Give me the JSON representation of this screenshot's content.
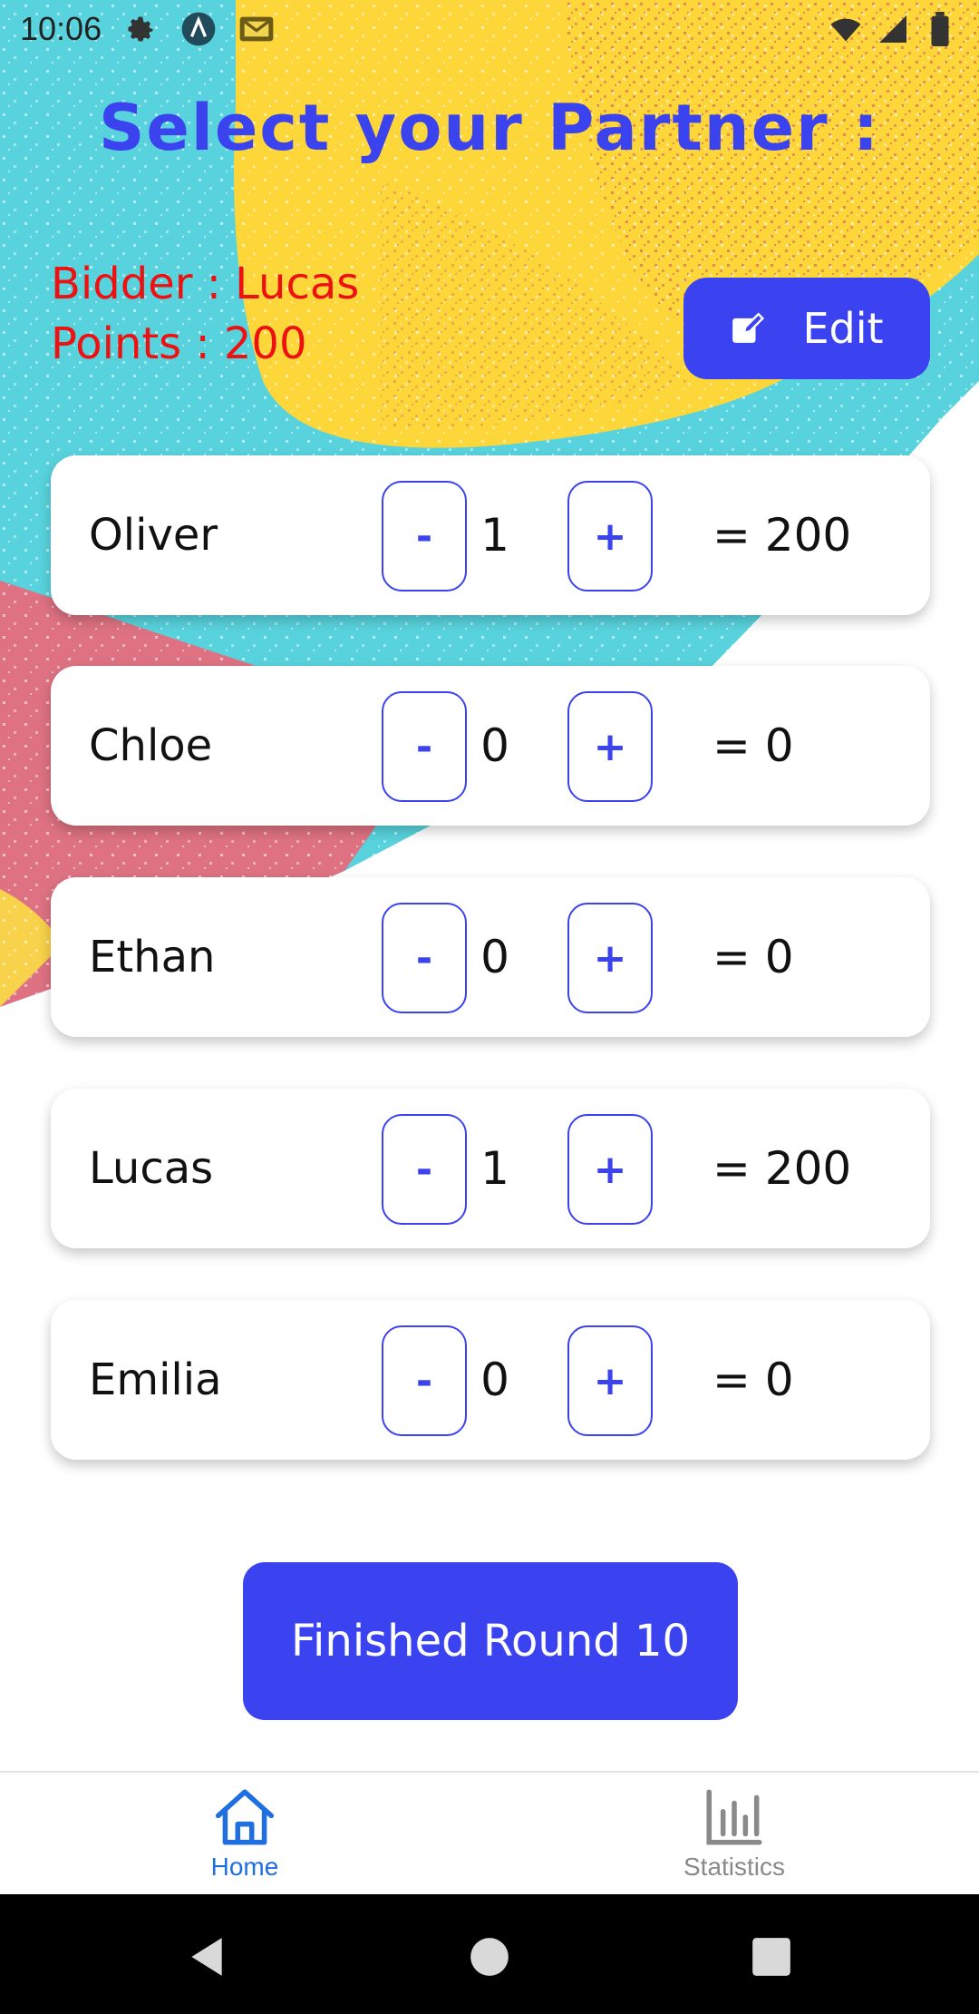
{
  "status_bar": {
    "time": "10:06",
    "icons": [
      "gear-icon",
      "android-studio-icon",
      "mail-icon",
      "wifi-icon",
      "signal-icon",
      "battery-icon"
    ]
  },
  "header": {
    "title": "Select your Partner :"
  },
  "bid": {
    "bidder_text": "Bidder : Lucas",
    "points_text": "Points : 200"
  },
  "edit_button": {
    "label": "Edit",
    "icon": "edit-icon"
  },
  "players": [
    {
      "name": "Oliver",
      "count": "1",
      "total": "= 200"
    },
    {
      "name": "Chloe",
      "count": "0",
      "total": "= 0"
    },
    {
      "name": "Ethan",
      "count": "0",
      "total": "= 0"
    },
    {
      "name": "Lucas",
      "count": "1",
      "total": "= 200"
    },
    {
      "name": "Emilia",
      "count": "0",
      "total": "= 0"
    }
  ],
  "stepper": {
    "minus": "-",
    "plus": "+"
  },
  "finish_button": {
    "label": "Finished Round 10"
  },
  "bottom_nav": {
    "items": [
      {
        "label": "Home",
        "icon": "home-icon",
        "active": true
      },
      {
        "label": "Statistics",
        "icon": "bar-chart-icon",
        "active": false
      }
    ]
  },
  "colors": {
    "accent": "#3b43f0",
    "bidder_text": "#ee1111",
    "active_tab": "#1f6fe0",
    "inactive_tab": "#8a8a8a"
  }
}
